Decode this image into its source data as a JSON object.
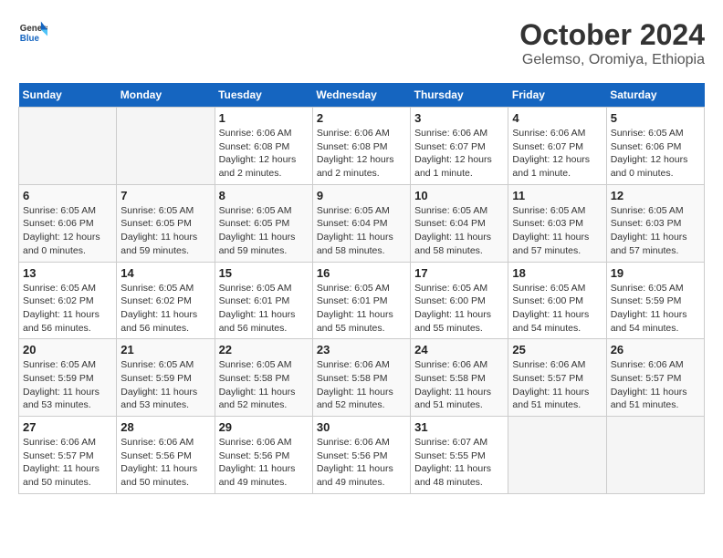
{
  "header": {
    "logo_general": "General",
    "logo_blue": "Blue",
    "title": "October 2024",
    "subtitle": "Gelemso, Oromiya, Ethiopia"
  },
  "weekdays": [
    "Sunday",
    "Monday",
    "Tuesday",
    "Wednesday",
    "Thursday",
    "Friday",
    "Saturday"
  ],
  "weeks": [
    [
      {
        "day": "",
        "sunrise": "",
        "sunset": "",
        "daylight": ""
      },
      {
        "day": "",
        "sunrise": "",
        "sunset": "",
        "daylight": ""
      },
      {
        "day": "1",
        "sunrise": "Sunrise: 6:06 AM",
        "sunset": "Sunset: 6:08 PM",
        "daylight": "Daylight: 12 hours and 2 minutes."
      },
      {
        "day": "2",
        "sunrise": "Sunrise: 6:06 AM",
        "sunset": "Sunset: 6:08 PM",
        "daylight": "Daylight: 12 hours and 2 minutes."
      },
      {
        "day": "3",
        "sunrise": "Sunrise: 6:06 AM",
        "sunset": "Sunset: 6:07 PM",
        "daylight": "Daylight: 12 hours and 1 minute."
      },
      {
        "day": "4",
        "sunrise": "Sunrise: 6:06 AM",
        "sunset": "Sunset: 6:07 PM",
        "daylight": "Daylight: 12 hours and 1 minute."
      },
      {
        "day": "5",
        "sunrise": "Sunrise: 6:05 AM",
        "sunset": "Sunset: 6:06 PM",
        "daylight": "Daylight: 12 hours and 0 minutes."
      }
    ],
    [
      {
        "day": "6",
        "sunrise": "Sunrise: 6:05 AM",
        "sunset": "Sunset: 6:06 PM",
        "daylight": "Daylight: 12 hours and 0 minutes."
      },
      {
        "day": "7",
        "sunrise": "Sunrise: 6:05 AM",
        "sunset": "Sunset: 6:05 PM",
        "daylight": "Daylight: 11 hours and 59 minutes."
      },
      {
        "day": "8",
        "sunrise": "Sunrise: 6:05 AM",
        "sunset": "Sunset: 6:05 PM",
        "daylight": "Daylight: 11 hours and 59 minutes."
      },
      {
        "day": "9",
        "sunrise": "Sunrise: 6:05 AM",
        "sunset": "Sunset: 6:04 PM",
        "daylight": "Daylight: 11 hours and 58 minutes."
      },
      {
        "day": "10",
        "sunrise": "Sunrise: 6:05 AM",
        "sunset": "Sunset: 6:04 PM",
        "daylight": "Daylight: 11 hours and 58 minutes."
      },
      {
        "day": "11",
        "sunrise": "Sunrise: 6:05 AM",
        "sunset": "Sunset: 6:03 PM",
        "daylight": "Daylight: 11 hours and 57 minutes."
      },
      {
        "day": "12",
        "sunrise": "Sunrise: 6:05 AM",
        "sunset": "Sunset: 6:03 PM",
        "daylight": "Daylight: 11 hours and 57 minutes."
      }
    ],
    [
      {
        "day": "13",
        "sunrise": "Sunrise: 6:05 AM",
        "sunset": "Sunset: 6:02 PM",
        "daylight": "Daylight: 11 hours and 56 minutes."
      },
      {
        "day": "14",
        "sunrise": "Sunrise: 6:05 AM",
        "sunset": "Sunset: 6:02 PM",
        "daylight": "Daylight: 11 hours and 56 minutes."
      },
      {
        "day": "15",
        "sunrise": "Sunrise: 6:05 AM",
        "sunset": "Sunset: 6:01 PM",
        "daylight": "Daylight: 11 hours and 56 minutes."
      },
      {
        "day": "16",
        "sunrise": "Sunrise: 6:05 AM",
        "sunset": "Sunset: 6:01 PM",
        "daylight": "Daylight: 11 hours and 55 minutes."
      },
      {
        "day": "17",
        "sunrise": "Sunrise: 6:05 AM",
        "sunset": "Sunset: 6:00 PM",
        "daylight": "Daylight: 11 hours and 55 minutes."
      },
      {
        "day": "18",
        "sunrise": "Sunrise: 6:05 AM",
        "sunset": "Sunset: 6:00 PM",
        "daylight": "Daylight: 11 hours and 54 minutes."
      },
      {
        "day": "19",
        "sunrise": "Sunrise: 6:05 AM",
        "sunset": "Sunset: 5:59 PM",
        "daylight": "Daylight: 11 hours and 54 minutes."
      }
    ],
    [
      {
        "day": "20",
        "sunrise": "Sunrise: 6:05 AM",
        "sunset": "Sunset: 5:59 PM",
        "daylight": "Daylight: 11 hours and 53 minutes."
      },
      {
        "day": "21",
        "sunrise": "Sunrise: 6:05 AM",
        "sunset": "Sunset: 5:59 PM",
        "daylight": "Daylight: 11 hours and 53 minutes."
      },
      {
        "day": "22",
        "sunrise": "Sunrise: 6:05 AM",
        "sunset": "Sunset: 5:58 PM",
        "daylight": "Daylight: 11 hours and 52 minutes."
      },
      {
        "day": "23",
        "sunrise": "Sunrise: 6:06 AM",
        "sunset": "Sunset: 5:58 PM",
        "daylight": "Daylight: 11 hours and 52 minutes."
      },
      {
        "day": "24",
        "sunrise": "Sunrise: 6:06 AM",
        "sunset": "Sunset: 5:58 PM",
        "daylight": "Daylight: 11 hours and 51 minutes."
      },
      {
        "day": "25",
        "sunrise": "Sunrise: 6:06 AM",
        "sunset": "Sunset: 5:57 PM",
        "daylight": "Daylight: 11 hours and 51 minutes."
      },
      {
        "day": "26",
        "sunrise": "Sunrise: 6:06 AM",
        "sunset": "Sunset: 5:57 PM",
        "daylight": "Daylight: 11 hours and 51 minutes."
      }
    ],
    [
      {
        "day": "27",
        "sunrise": "Sunrise: 6:06 AM",
        "sunset": "Sunset: 5:57 PM",
        "daylight": "Daylight: 11 hours and 50 minutes."
      },
      {
        "day": "28",
        "sunrise": "Sunrise: 6:06 AM",
        "sunset": "Sunset: 5:56 PM",
        "daylight": "Daylight: 11 hours and 50 minutes."
      },
      {
        "day": "29",
        "sunrise": "Sunrise: 6:06 AM",
        "sunset": "Sunset: 5:56 PM",
        "daylight": "Daylight: 11 hours and 49 minutes."
      },
      {
        "day": "30",
        "sunrise": "Sunrise: 6:06 AM",
        "sunset": "Sunset: 5:56 PM",
        "daylight": "Daylight: 11 hours and 49 minutes."
      },
      {
        "day": "31",
        "sunrise": "Sunrise: 6:07 AM",
        "sunset": "Sunset: 5:55 PM",
        "daylight": "Daylight: 11 hours and 48 minutes."
      },
      {
        "day": "",
        "sunrise": "",
        "sunset": "",
        "daylight": ""
      },
      {
        "day": "",
        "sunrise": "",
        "sunset": "",
        "daylight": ""
      }
    ]
  ]
}
